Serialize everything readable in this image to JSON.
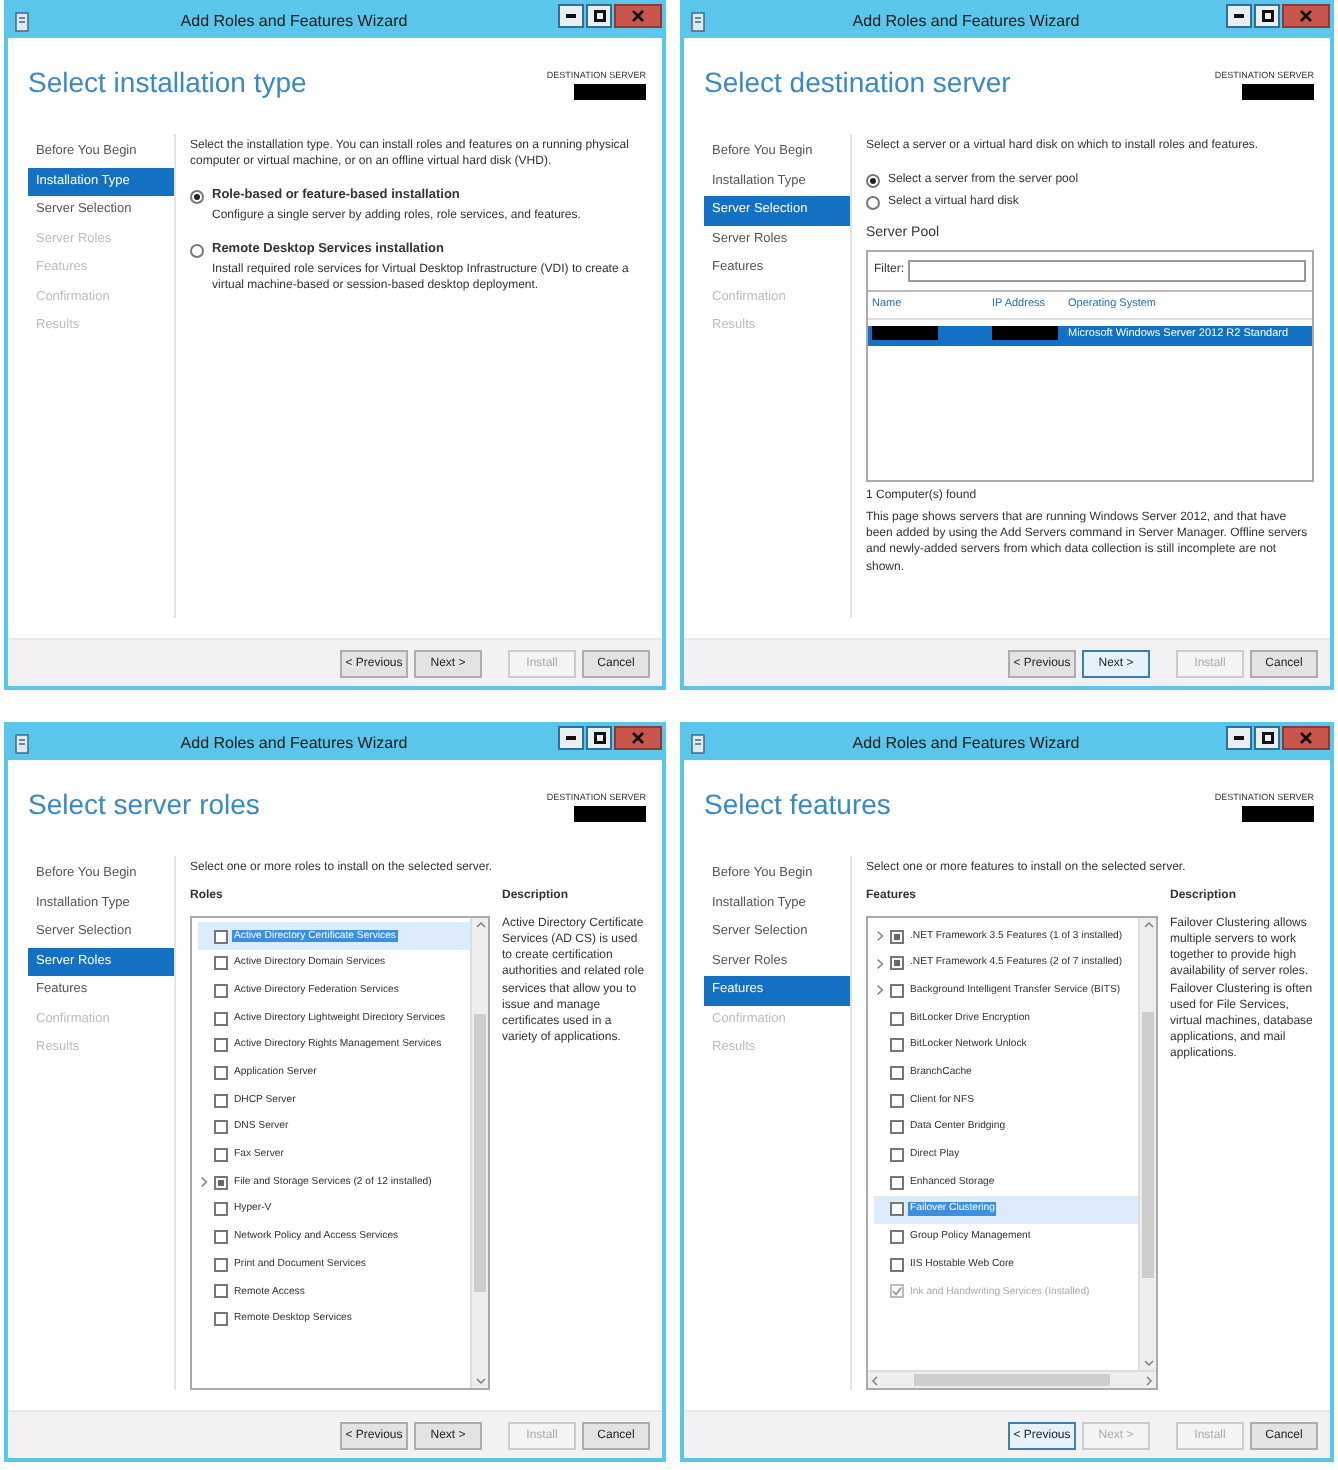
{
  "windows": [
    {
      "title": "Add Roles and Features Wizard",
      "heading": "Select installation type",
      "destination_label": "DESTINATION SERVER",
      "steps": [
        {
          "label": "Before You Begin",
          "selected": false,
          "disabled": false
        },
        {
          "label": "Installation Type",
          "selected": true,
          "disabled": false
        },
        {
          "label": "Server Selection",
          "selected": false,
          "disabled": false
        },
        {
          "label": "Server Roles",
          "selected": false,
          "disabled": true
        },
        {
          "label": "Features",
          "selected": false,
          "disabled": true
        },
        {
          "label": "Confirmation",
          "selected": false,
          "disabled": true
        },
        {
          "label": "Results",
          "selected": false,
          "disabled": true
        }
      ],
      "content": {
        "kind": "installation_type",
        "intro": "Select the installation type. You can install roles and features on a running physical computer or virtual machine, or on an offline virtual hard disk (VHD).",
        "options": [
          {
            "label": "Role-based or feature-based installation",
            "description": "Configure a single server by adding roles, role services, and features.",
            "selected": true
          },
          {
            "label": "Remote Desktop Services installation",
            "description": "Install required role services for Virtual Desktop Infrastructure (VDI) to create a virtual machine-based or session-based desktop deployment.",
            "selected": false
          }
        ]
      },
      "buttons": [
        {
          "label": "< Previous",
          "disabled": false,
          "focused": false
        },
        {
          "label": "Next >",
          "disabled": false,
          "focused": false
        },
        {
          "label": "Install",
          "disabled": true,
          "focused": false
        },
        {
          "label": "Cancel",
          "disabled": false,
          "focused": false
        }
      ]
    },
    {
      "title": "Add Roles and Features Wizard",
      "heading": "Select destination server",
      "destination_label": "DESTINATION SERVER",
      "steps": [
        {
          "label": "Before You Begin",
          "selected": false,
          "disabled": false
        },
        {
          "label": "Installation Type",
          "selected": false,
          "disabled": false
        },
        {
          "label": "Server Selection",
          "selected": true,
          "disabled": false
        },
        {
          "label": "Server Roles",
          "selected": false,
          "disabled": false
        },
        {
          "label": "Features",
          "selected": false,
          "disabled": false
        },
        {
          "label": "Confirmation",
          "selected": false,
          "disabled": true
        },
        {
          "label": "Results",
          "selected": false,
          "disabled": true
        }
      ],
      "content": {
        "kind": "server_selection",
        "intro": "Select a server or a virtual hard disk on which to install roles and features.",
        "options": [
          {
            "label": "Select a server from the server pool",
            "selected": true
          },
          {
            "label": "Select a virtual hard disk",
            "selected": false
          }
        ],
        "pool_label": "Server Pool",
        "filter_label": "Filter:",
        "columns": [
          "Name",
          "IP Address",
          "Operating System"
        ],
        "rows": [
          {
            "os": "Microsoft Windows Server 2012 R2 Standard",
            "selected": true
          }
        ],
        "count": "1 Computer(s) found",
        "note": "This page shows servers that are running Windows Server 2012, and that have been added by using the Add Servers command in Server Manager. Offline servers and newly-added servers from which data collection is still incomplete are not shown."
      },
      "buttons": [
        {
          "label": "< Previous",
          "disabled": false,
          "focused": false
        },
        {
          "label": "Next >",
          "disabled": false,
          "focused": true
        },
        {
          "label": "Install",
          "disabled": true,
          "focused": false
        },
        {
          "label": "Cancel",
          "disabled": false,
          "focused": false
        }
      ]
    },
    {
      "title": "Add Roles and Features Wizard",
      "heading": "Select server roles",
      "destination_label": "DESTINATION SERVER",
      "steps": [
        {
          "label": "Before You Begin",
          "selected": false,
          "disabled": false
        },
        {
          "label": "Installation Type",
          "selected": false,
          "disabled": false
        },
        {
          "label": "Server Selection",
          "selected": false,
          "disabled": false
        },
        {
          "label": "Server Roles",
          "selected": true,
          "disabled": false
        },
        {
          "label": "Features",
          "selected": false,
          "disabled": false
        },
        {
          "label": "Confirmation",
          "selected": false,
          "disabled": true
        },
        {
          "label": "Results",
          "selected": false,
          "disabled": true
        }
      ],
      "content": {
        "kind": "checklist",
        "intro": "Select one or more roles to install on the selected server.",
        "list_label": "Roles",
        "description_label": "Description",
        "description": "Active Directory Certificate Services (AD CS) is used to create certification authorities and related role services that allow you to issue and manage certificates used in a variety of applications.",
        "horizontal_scrollbar": false,
        "items": [
          {
            "label": "Active Directory Certificate Services",
            "checked": false,
            "partial": false,
            "expandable": false,
            "selected": true,
            "disabled": false
          },
          {
            "label": "Active Directory Domain Services",
            "checked": false,
            "partial": false,
            "expandable": false,
            "selected": false,
            "disabled": false
          },
          {
            "label": "Active Directory Federation Services",
            "checked": false,
            "partial": false,
            "expandable": false,
            "selected": false,
            "disabled": false
          },
          {
            "label": "Active Directory Lightweight Directory Services",
            "checked": false,
            "partial": false,
            "expandable": false,
            "selected": false,
            "disabled": false
          },
          {
            "label": "Active Directory Rights Management Services",
            "checked": false,
            "partial": false,
            "expandable": false,
            "selected": false,
            "disabled": false
          },
          {
            "label": "Application Server",
            "checked": false,
            "partial": false,
            "expandable": false,
            "selected": false,
            "disabled": false
          },
          {
            "label": "DHCP Server",
            "checked": false,
            "partial": false,
            "expandable": false,
            "selected": false,
            "disabled": false
          },
          {
            "label": "DNS Server",
            "checked": false,
            "partial": false,
            "expandable": false,
            "selected": false,
            "disabled": false
          },
          {
            "label": "Fax Server",
            "checked": false,
            "partial": false,
            "expandable": false,
            "selected": false,
            "disabled": false
          },
          {
            "label": "File and Storage Services (2 of 12 installed)",
            "checked": false,
            "partial": true,
            "expandable": true,
            "selected": false,
            "disabled": false
          },
          {
            "label": "Hyper-V",
            "checked": false,
            "partial": false,
            "expandable": false,
            "selected": false,
            "disabled": false
          },
          {
            "label": "Network Policy and Access Services",
            "checked": false,
            "partial": false,
            "expandable": false,
            "selected": false,
            "disabled": false
          },
          {
            "label": "Print and Document Services",
            "checked": false,
            "partial": false,
            "expandable": false,
            "selected": false,
            "disabled": false
          },
          {
            "label": "Remote Access",
            "checked": false,
            "partial": false,
            "expandable": false,
            "selected": false,
            "disabled": false
          },
          {
            "label": "Remote Desktop Services",
            "checked": false,
            "partial": false,
            "expandable": false,
            "selected": false,
            "disabled": false
          }
        ]
      },
      "buttons": [
        {
          "label": "< Previous",
          "disabled": false,
          "focused": false
        },
        {
          "label": "Next >",
          "disabled": false,
          "focused": false
        },
        {
          "label": "Install",
          "disabled": true,
          "focused": false
        },
        {
          "label": "Cancel",
          "disabled": false,
          "focused": false
        }
      ]
    },
    {
      "title": "Add Roles and Features Wizard",
      "heading": "Select features",
      "destination_label": "DESTINATION SERVER",
      "steps": [
        {
          "label": "Before You Begin",
          "selected": false,
          "disabled": false
        },
        {
          "label": "Installation Type",
          "selected": false,
          "disabled": false
        },
        {
          "label": "Server Selection",
          "selected": false,
          "disabled": false
        },
        {
          "label": "Server Roles",
          "selected": false,
          "disabled": false
        },
        {
          "label": "Features",
          "selected": true,
          "disabled": false
        },
        {
          "label": "Confirmation",
          "selected": false,
          "disabled": true
        },
        {
          "label": "Results",
          "selected": false,
          "disabled": true
        }
      ],
      "content": {
        "kind": "checklist",
        "intro": "Select one or more features to install on the selected server.",
        "list_label": "Features",
        "description_label": "Description",
        "description": "Failover Clustering allows multiple servers to work together to provide high availability of server roles. Failover Clustering is often used for File Services, virtual machines, database applications, and mail applications.",
        "horizontal_scrollbar": true,
        "items": [
          {
            "label": ".NET Framework 3.5 Features (1 of 3 installed)",
            "checked": false,
            "partial": true,
            "expandable": true,
            "selected": false,
            "disabled": false
          },
          {
            "label": ".NET Framework 4.5 Features (2 of 7 installed)",
            "checked": false,
            "partial": true,
            "expandable": true,
            "selected": false,
            "disabled": false
          },
          {
            "label": "Background Intelligent Transfer Service (BITS)",
            "checked": false,
            "partial": false,
            "expandable": true,
            "selected": false,
            "disabled": false
          },
          {
            "label": "BitLocker Drive Encryption",
            "checked": false,
            "partial": false,
            "expandable": false,
            "selected": false,
            "disabled": false
          },
          {
            "label": "BitLocker Network Unlock",
            "checked": false,
            "partial": false,
            "expandable": false,
            "selected": false,
            "disabled": false
          },
          {
            "label": "BranchCache",
            "checked": false,
            "partial": false,
            "expandable": false,
            "selected": false,
            "disabled": false
          },
          {
            "label": "Client for NFS",
            "checked": false,
            "partial": false,
            "expandable": false,
            "selected": false,
            "disabled": false
          },
          {
            "label": "Data Center Bridging",
            "checked": false,
            "partial": false,
            "expandable": false,
            "selected": false,
            "disabled": false
          },
          {
            "label": "Direct Play",
            "checked": false,
            "partial": false,
            "expandable": false,
            "selected": false,
            "disabled": false
          },
          {
            "label": "Enhanced Storage",
            "checked": false,
            "partial": false,
            "expandable": false,
            "selected": false,
            "disabled": false
          },
          {
            "label": "Failover Clustering",
            "checked": false,
            "partial": false,
            "expandable": false,
            "selected": true,
            "disabled": false
          },
          {
            "label": "Group Policy Management",
            "checked": false,
            "partial": false,
            "expandable": false,
            "selected": false,
            "disabled": false
          },
          {
            "label": "IIS Hostable Web Core",
            "checked": false,
            "partial": false,
            "expandable": false,
            "selected": false,
            "disabled": false
          },
          {
            "label": "Ink and Handwriting Services (Installed)",
            "checked": true,
            "partial": false,
            "expandable": false,
            "selected": false,
            "disabled": true
          }
        ]
      },
      "buttons": [
        {
          "label": "< Previous",
          "disabled": false,
          "focused": true
        },
        {
          "label": "Next >",
          "disabled": true,
          "focused": false
        },
        {
          "label": "Install",
          "disabled": true,
          "focused": false
        },
        {
          "label": "Cancel",
          "disabled": false,
          "focused": false
        }
      ]
    }
  ]
}
